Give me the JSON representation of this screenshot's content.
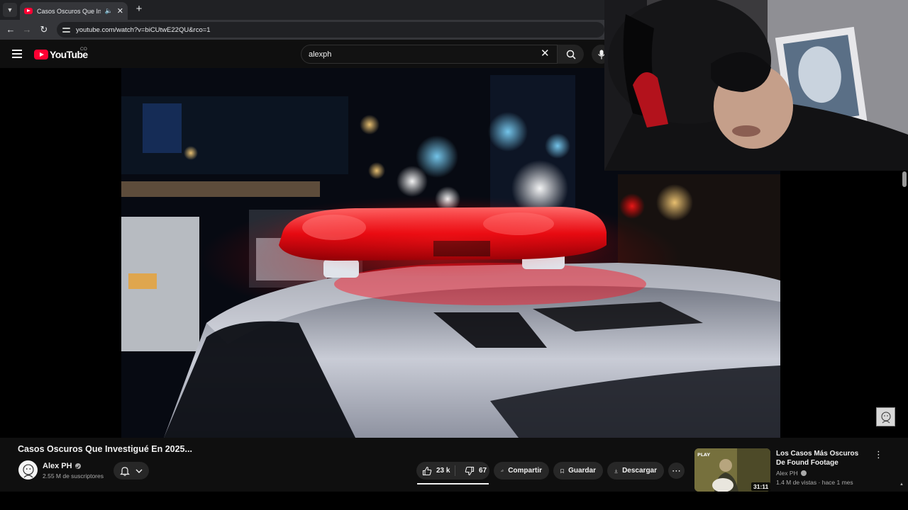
{
  "browser": {
    "tab_title": "Casos Oscuros Que Investig",
    "url": "youtube.com/watch?v=biCUtwE22QU&rco=1"
  },
  "masthead": {
    "logo_text": "YouTube",
    "country_code": "CO",
    "search_value": "alexph"
  },
  "video": {
    "title": "Casos Oscuros Que Investigué En 2025...",
    "channel_name": "Alex PH",
    "subscribers": "2.55 M de suscriptores",
    "likes": "23 k",
    "dislikes": "67",
    "share_label": "Compartir",
    "save_label": "Guardar",
    "download_label": "Descargar"
  },
  "recommended": {
    "title": "Los Casos Más Oscuros De Found Footage",
    "channel": "Alex PH",
    "meta": "1.4 M de vistas · hace 1 mes",
    "duration": "31:11",
    "thumb_badge": "PLAY"
  },
  "colors": {
    "background": "#0f0f0f",
    "brand_red": "#ff0033",
    "pill_bg": "#272727"
  }
}
